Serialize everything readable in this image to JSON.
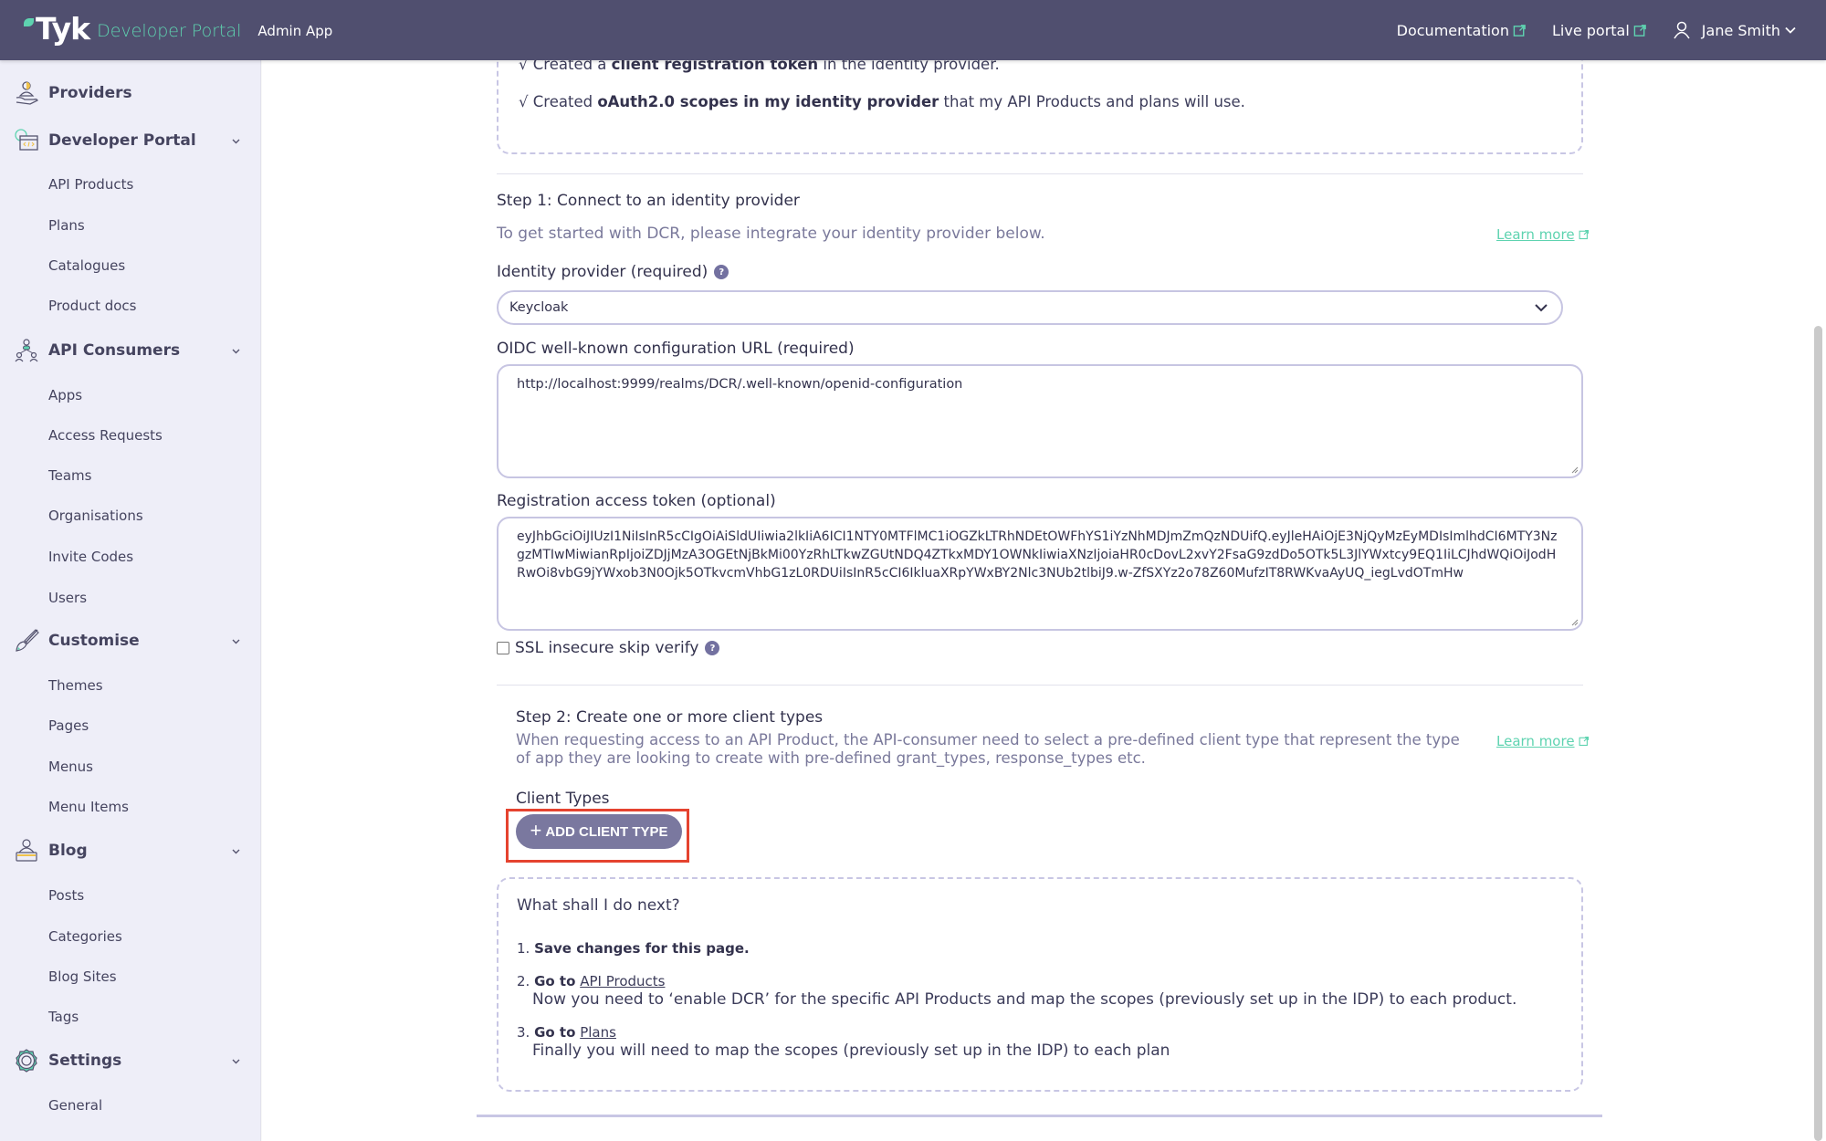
{
  "header": {
    "brand_name": "Tyk",
    "brand_product": "Developer Portal",
    "app_label": "Admin App",
    "nav": [
      {
        "label": "Documentation",
        "icon": "external-link-icon"
      },
      {
        "label": "Live portal",
        "icon": "external-link-icon"
      }
    ],
    "user": {
      "name": "Jane Smith",
      "icon": "user-icon"
    }
  },
  "sidebar": {
    "sections": [
      {
        "label": "Providers",
        "icon": "providers-icon",
        "items": []
      },
      {
        "label": "Developer Portal",
        "icon": "developer-portal-icon",
        "items": [
          "API Products",
          "Plans",
          "Catalogues",
          "Product docs"
        ]
      },
      {
        "label": "API Consumers",
        "icon": "api-consumers-icon",
        "items": [
          "Apps",
          "Access Requests",
          "Teams",
          "Organisations",
          "Invite Codes",
          "Users"
        ]
      },
      {
        "label": "Customise",
        "icon": "brush-icon",
        "items": [
          "Themes",
          "Pages",
          "Menus",
          "Menu Items"
        ]
      },
      {
        "label": "Blog",
        "icon": "blog-icon",
        "items": [
          "Posts",
          "Categories",
          "Blog Sites",
          "Tags"
        ]
      },
      {
        "label": "Settings",
        "icon": "gear-icon",
        "items": [
          "General"
        ]
      }
    ]
  },
  "prereq": {
    "lines": [
      {
        "check": "√",
        "pre": "Created a ",
        "bold": "client registration token",
        "post": " in the identity provider."
      },
      {
        "check": "√",
        "pre": "Created ",
        "bold": "oAuth2.0 scopes in my identity provider",
        "post": " that my API Products and plans will use."
      }
    ]
  },
  "step1": {
    "title": "Step 1: Connect to an identity provider",
    "subtitle": "To get started with DCR, please integrate your identity provider below.",
    "learn_more": "Learn more",
    "idp_label": "Identity provider (required)",
    "idp_value": "Keycloak",
    "oidc_label": "OIDC well-known configuration URL (required)",
    "oidc_value": "http://localhost:9999/realms/DCR/.well-known/openid-configuration",
    "token_label": "Registration access token (optional)",
    "token_value": "eyJhbGciOiJIUzI1NiIsInR5cCIgOiAiSldUIiwia2lkIiA6ICI1NTY0MTFlMC1iOGZkLTRhNDEtOWFhYS1iYzNhMDJmZmQzNDUifQ.eyJleHAiOjE3NjQyMzEyMDIsImlhdCI6MTY3NzgzMTIwMiwianRpIjoiZDJjMzA3OGEtNjBkMi00YzRhLTkwZGUtNDQ4ZTkxMDY1OWNkIiwiaXNzIjoiaHR0cDovL2xvY2FsaG9zdDo5OTk5L3JlYWxtcy9EQ1IiLCJhdWQiOiJodHRwOi8vbG9jYWxob3N0Ojk5OTkvcmVhbG1zL0RDUiIsInR5cCI6IkluaXRpYWxBY2Nlc3NUb2tlbiJ9.w-ZfSXYz2o78Z60MufzIT8RWKvaAyUQ_iegLvdOTmHw",
    "ssl_label": "SSL insecure skip verify",
    "ssl_checked": false
  },
  "step2": {
    "title": "Step 2: Create one or more client types",
    "subtitle_line1": "When requesting access to an API Product, the API-consumer need to select a pre-defined client type that represent the type",
    "subtitle_line2": "of app they are looking to create with pre-defined grant_types, response_types etc.",
    "learn_more": "Learn more",
    "client_types_label": "Client Types",
    "add_button": "ADD CLIENT TYPE"
  },
  "next": {
    "title": "What shall I do next?",
    "steps": [
      {
        "num": "1.",
        "bold": "Save changes for this page.",
        "link": "",
        "desc": ""
      },
      {
        "num": "2.",
        "bold": "Go to",
        "link": "API Products",
        "desc": "Now you need to ‘enable DCR’ for the specific API Products and map the scopes (previously set up in the IDP) to each product."
      },
      {
        "num": "3.",
        "bold": "Go to",
        "link": "Plans",
        "desc": "Finally you will need to map the scopes (previously set up in the IDP) to each plan"
      }
    ]
  },
  "colors": {
    "header_bg": "#504f6f",
    "accent": "#5ed3b0",
    "sidebar_bg": "#eeeef8",
    "button_bg": "#7a789f",
    "highlight": "#e5432f"
  }
}
